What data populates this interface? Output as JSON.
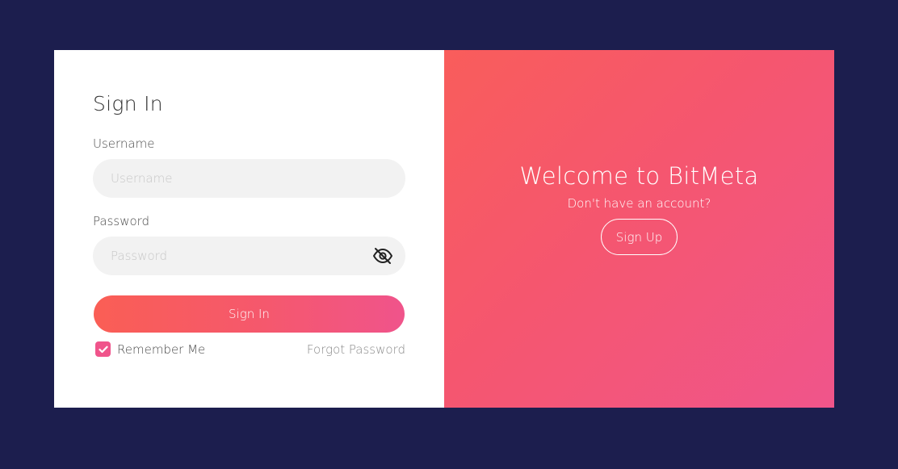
{
  "signin": {
    "title": "Sign In",
    "username_label": "Username",
    "username_placeholder": "Username",
    "username_value": "",
    "password_label": "Password",
    "password_placeholder": "Password",
    "password_value": "",
    "button_label": "Sign In",
    "remember_label": "Remember Me",
    "remember_checked": true,
    "forgot_label": "Forgot Password"
  },
  "welcome": {
    "title": "Welcome to BitMeta",
    "subtitle": "Don't have an account?",
    "signup_label": "Sign Up"
  },
  "icons": {
    "password_toggle": "eye-slash-icon",
    "checkbox": "checkmark-icon"
  },
  "colors": {
    "background": "#1c1e4e",
    "accent_start": "#fa5e55",
    "accent_end": "#f0548b",
    "field_bg": "#f2f2f2"
  }
}
